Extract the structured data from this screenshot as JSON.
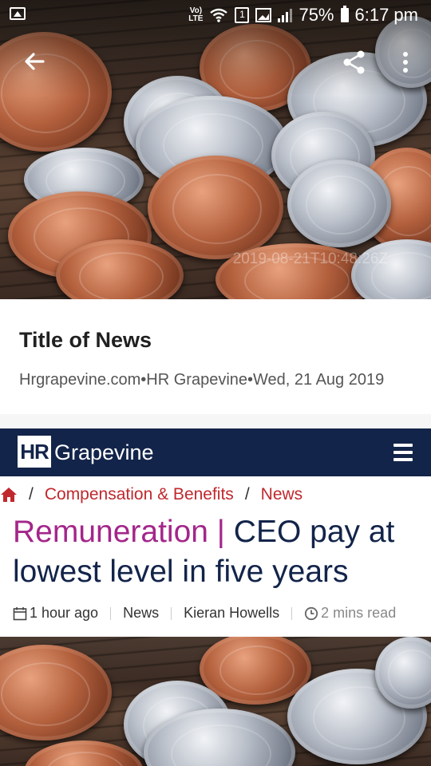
{
  "status_bar": {
    "volte_top": "Vo)",
    "volte_bottom": "LTE",
    "sim_number": "1",
    "battery": "75%",
    "time": "6:17 pm"
  },
  "hero": {
    "timestamp": "2019-08-21T10:48:26Z"
  },
  "news_card": {
    "title": "Title of News",
    "meta": "Hrgrapevine.com•HR Grapevine•Wed, 21 Aug 2019"
  },
  "site": {
    "logo_hr": "HR",
    "logo_name": "Grapevine"
  },
  "breadcrumb": {
    "sep1": "/",
    "category": "Compensation & Benefits",
    "sep2": "/",
    "section": "News"
  },
  "article": {
    "kicker": "Remuneration |",
    "headline": "CEO pay at lowest level in five years",
    "time_ago": "1 hour ago",
    "section": "News",
    "author": "Kieran Howells",
    "read_time": "2 mins read"
  },
  "colors": {
    "brand_navy": "#13244a",
    "breadcrumb_red": "#c0282d",
    "kicker_magenta": "#a3268a"
  },
  "icons": [
    "image-icon",
    "signal-bars-icon",
    "battery-icon",
    "back-arrow-icon",
    "share-icon",
    "more-vert-icon",
    "menu-icon",
    "home-icon",
    "calendar-icon",
    "clock-icon"
  ]
}
